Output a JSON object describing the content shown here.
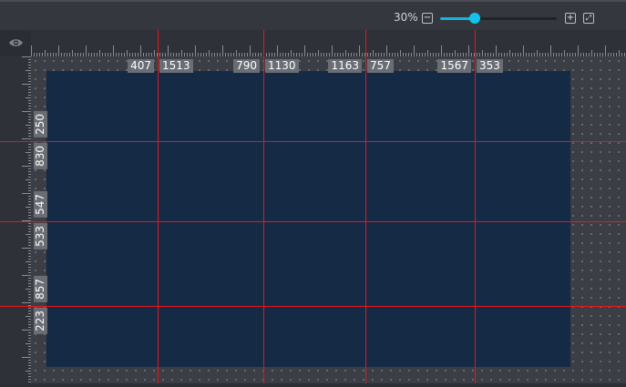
{
  "toolbar": {
    "zoom_label": "30%",
    "zoom_value": 0.3
  },
  "guides": {
    "vertical": [
      {
        "name": "v1",
        "left": "407",
        "right": "1513"
      },
      {
        "name": "v2",
        "left": "790",
        "right": "1130"
      },
      {
        "name": "v3",
        "left": "1163",
        "right": "757"
      },
      {
        "name": "v4",
        "left": "1567",
        "right": "353"
      }
    ],
    "horizontal": [
      {
        "name": "h1",
        "above": "250",
        "below": "830"
      },
      {
        "name": "h2",
        "above": "547",
        "below": "533"
      },
      {
        "name": "h3",
        "above": "857",
        "below": "223"
      }
    ]
  },
  "colors": {
    "guide": "#e8161b",
    "canvas": "#142a45",
    "accent": "#13b5e5"
  }
}
